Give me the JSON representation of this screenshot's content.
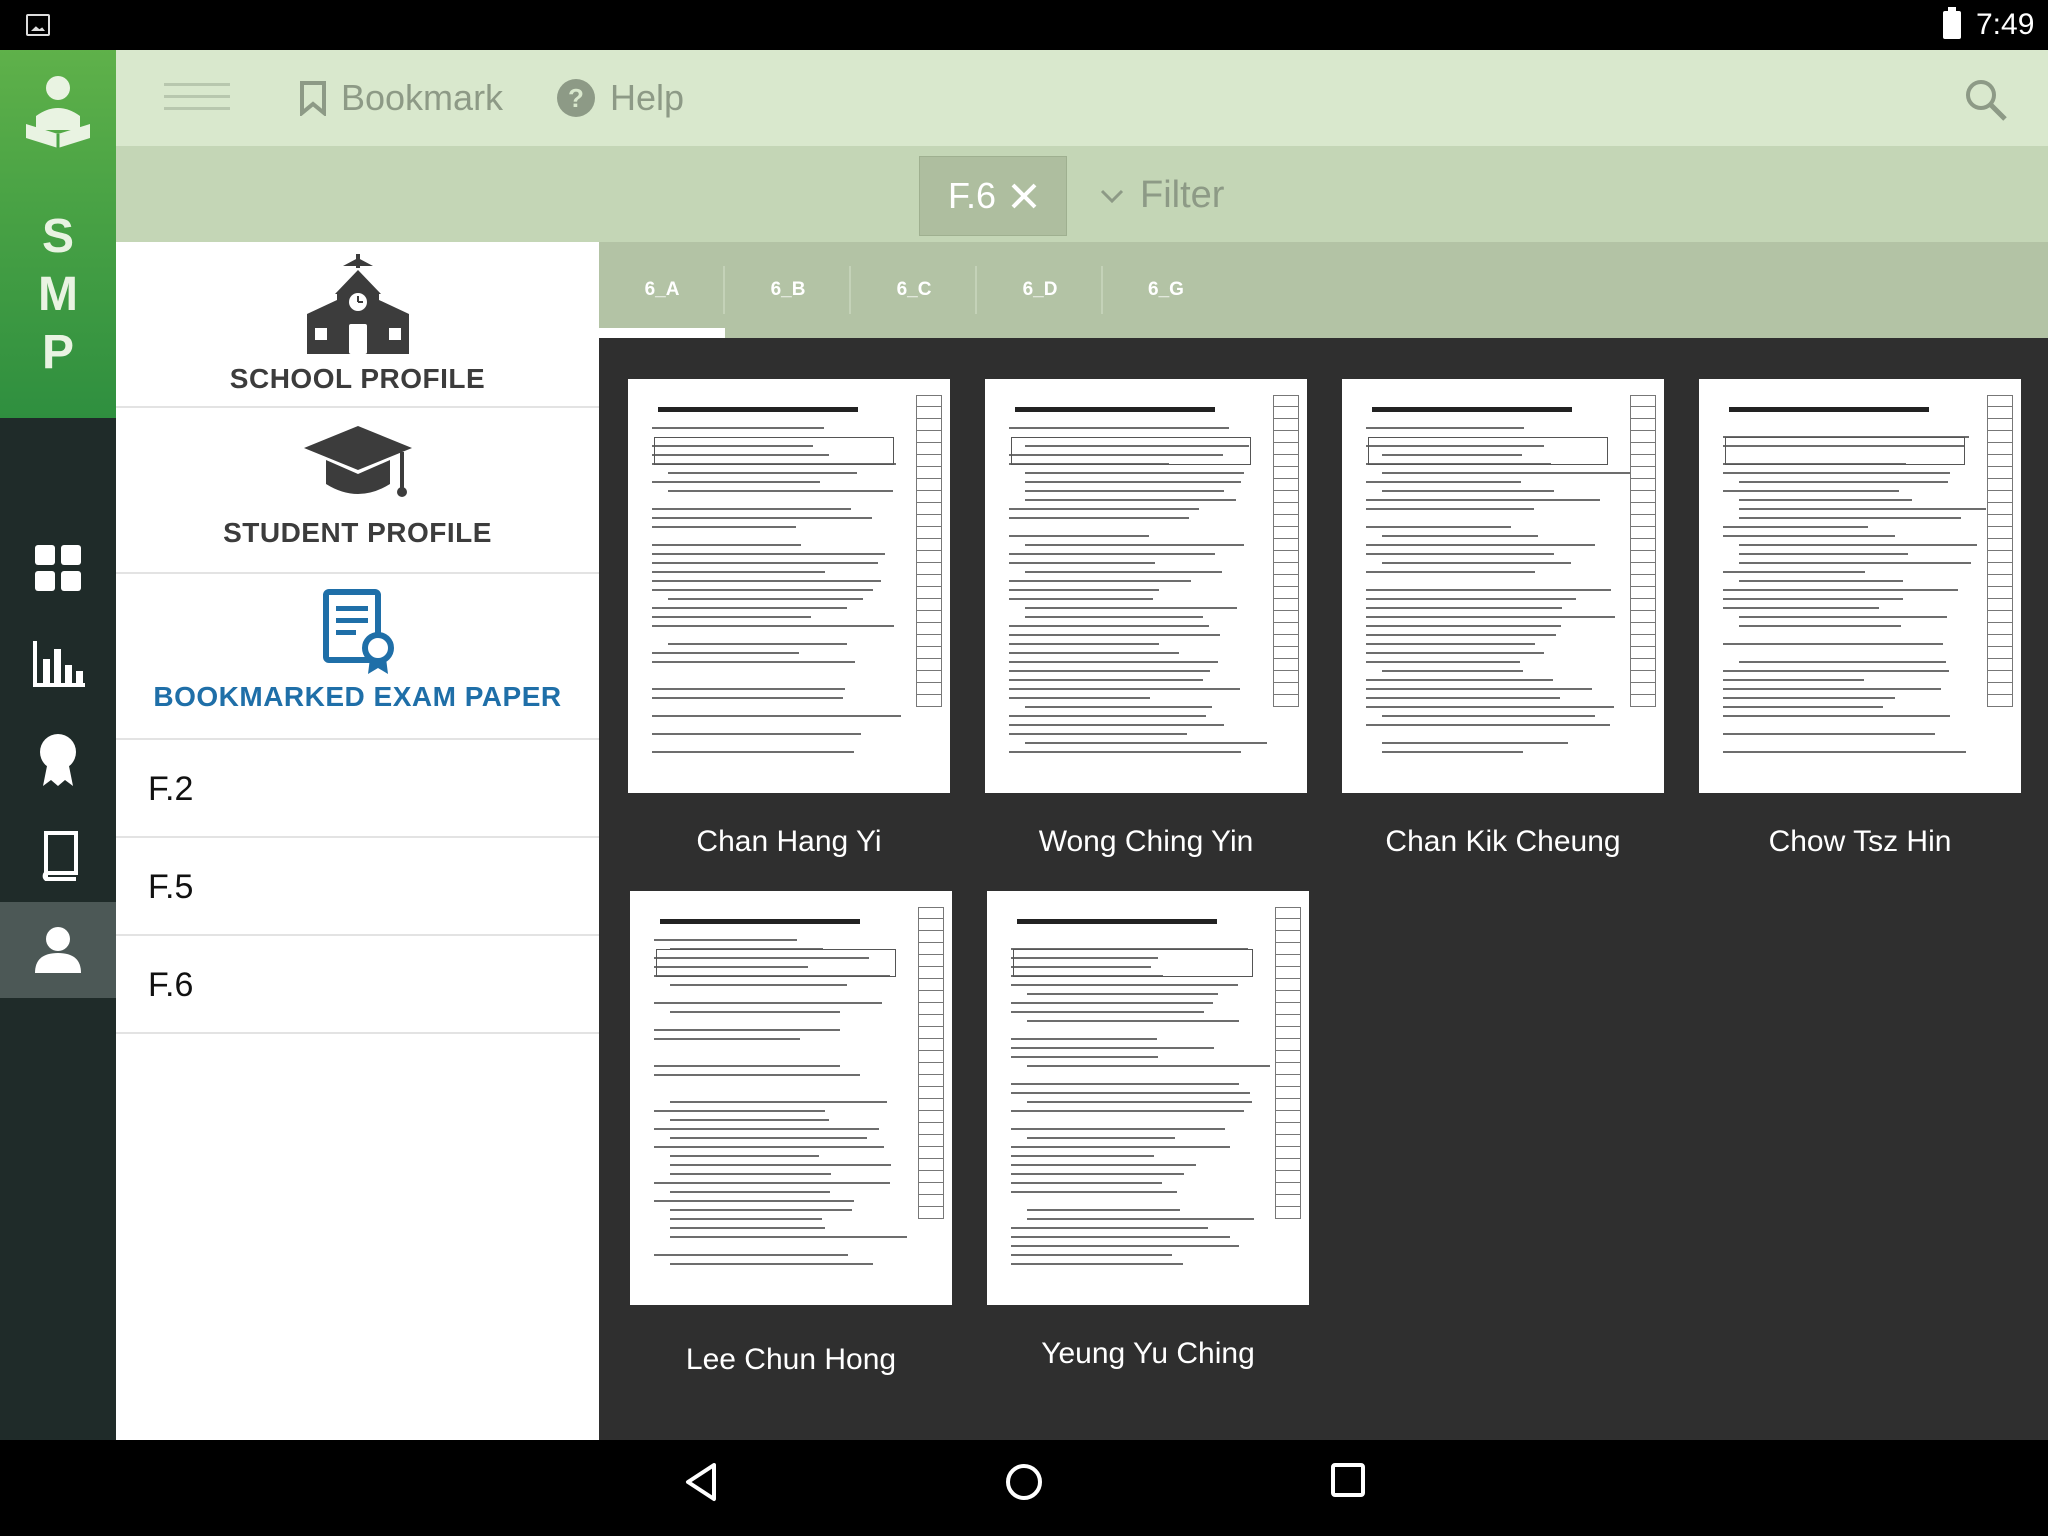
{
  "status_bar": {
    "time": "7:49"
  },
  "rail": {
    "logo_letters": [
      "S",
      "M",
      "P"
    ],
    "nav_icons": [
      "dashboard-icon",
      "bar-chart-icon",
      "award-icon",
      "book-icon",
      "user-icon"
    ],
    "active_index": 4
  },
  "toolbar": {
    "bookmark_label": "Bookmark",
    "help_label": "Help"
  },
  "filter_bar": {
    "chip_label": "F.6",
    "filter_label": "Filter"
  },
  "side_panel": {
    "school_profile": "SCHOOL PROFILE",
    "student_profile": "STUDENT PROFILE",
    "bookmarked_exam_paper": "BOOKMARKED EXAM PAPER",
    "classes": [
      "F.2",
      "F.5",
      "F.6"
    ]
  },
  "tabs": [
    "6_A",
    "6_B",
    "6_C",
    "6_D",
    "6_G"
  ],
  "active_tab": "6_A",
  "students": [
    {
      "name": "Chan Hang Yi"
    },
    {
      "name": "Wong Ching Yin"
    },
    {
      "name": "Chan Kik Cheung"
    },
    {
      "name": "Chow Tsz Hin"
    },
    {
      "name": "Lee Chun Hong"
    },
    {
      "name": "Yeung Yu Ching"
    }
  ],
  "colors": {
    "brand_green": "#4aa345",
    "toolbar_bg": "#d9e8cd",
    "filter_bg": "#c4d6b6",
    "tab_bg": "#b3c3a5",
    "content_bg": "#2f2f2f",
    "accent_blue": "#1f6fa8"
  }
}
